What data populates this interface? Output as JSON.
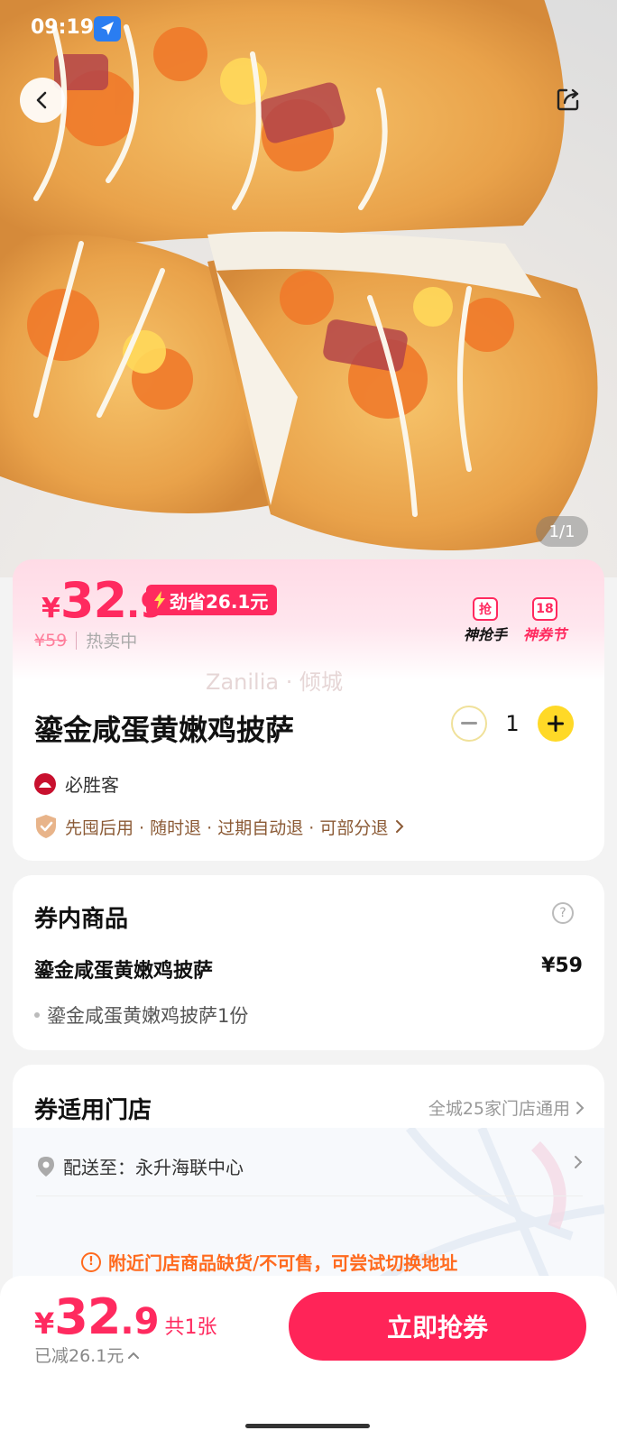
{
  "status_bar": {
    "time": "09:19"
  },
  "hero": {
    "page_indicator": "1/1"
  },
  "price": {
    "currency": "¥",
    "integer": "32",
    "decimal": ".9",
    "save_label": "劲省26.1元",
    "original_price": "¥59",
    "status": "热卖中",
    "promos": [
      {
        "icon_text": "抢",
        "label": "神抢手"
      },
      {
        "icon_text": "18",
        "label": "神券节"
      }
    ]
  },
  "watermark": "Zanilia · 倾城",
  "product": {
    "title": "鎏金咸蛋黄嫩鸡披萨",
    "quantity": "1",
    "brand_logo_text": "必胜客",
    "brand": "必胜客",
    "policy": "先囤后用 · 随时退 · 过期自动退 · 可部分退"
  },
  "coupon_items": {
    "title": "券内商品",
    "help_glyph": "?",
    "item_name": "鎏金咸蛋黄嫩鸡披萨",
    "item_price": "¥59",
    "item_detail": "鎏金咸蛋黄嫩鸡披萨1份"
  },
  "stores": {
    "title": "券适用门店",
    "link": "全城25家门店通用",
    "deliver_label": "配送至：永升海联中心",
    "warning_glyph": "!",
    "warning": "附近门店商品缺货/不可售，可尝试切换地址"
  },
  "bottom_bar": {
    "currency": "¥",
    "integer": "32",
    "decimal": ".9",
    "count": "共1张",
    "reduced": "已减26.1元",
    "buy_button": "立即抢券"
  },
  "colors": {
    "accent": "#ff2a5f",
    "button": "#ff2458",
    "stepper_yellow": "#ffd927",
    "warning": "#ff6a1e"
  }
}
